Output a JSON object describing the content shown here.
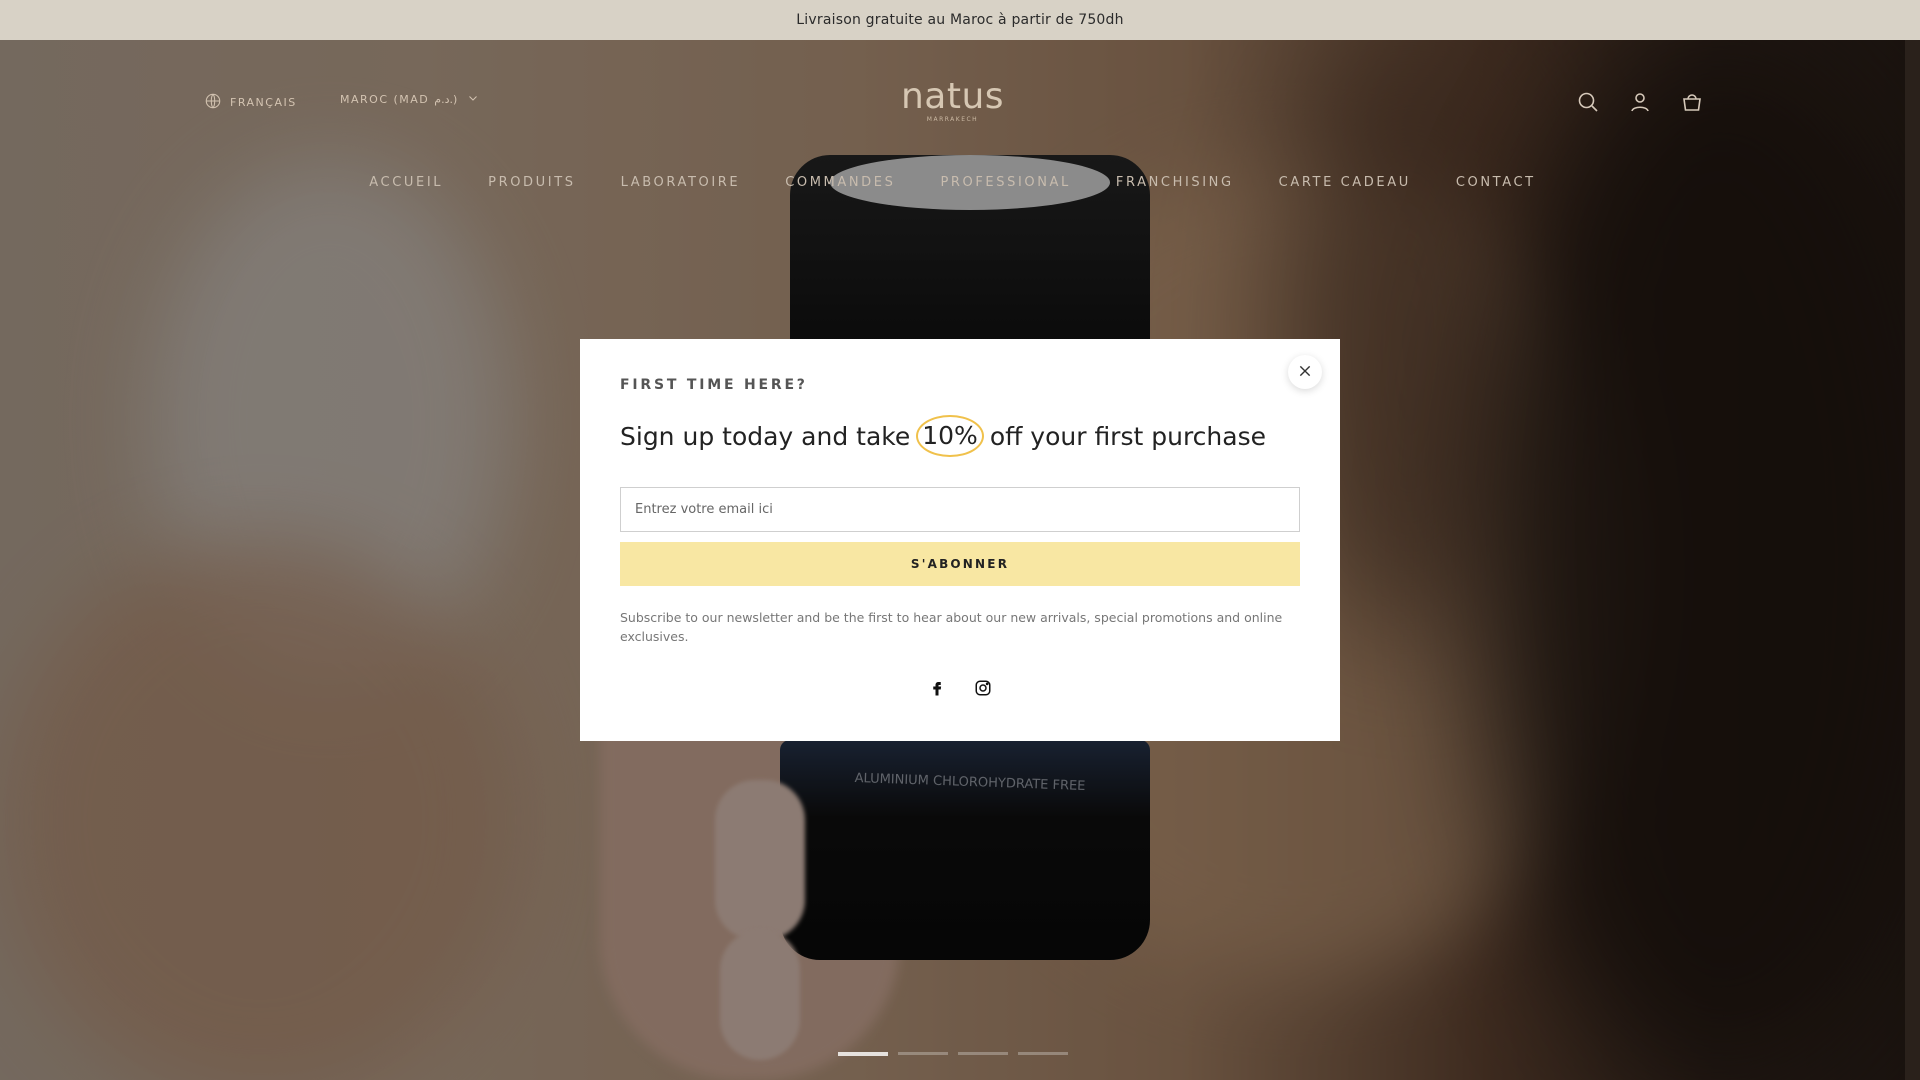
{
  "announcement": {
    "text": "Livraison gratuite au Maroc à partir de 750dh"
  },
  "header": {
    "language": "FRANÇAIS",
    "currency": "MAROC (MAD د.م.)",
    "logo": {
      "name": "natus",
      "tagline": "MARRAKECH"
    },
    "icons": [
      "search-icon",
      "account-icon",
      "cart-icon"
    ]
  },
  "nav": {
    "items": [
      {
        "label": "ACCUEIL"
      },
      {
        "label": "PRODUITS"
      },
      {
        "label": "LABORATOIRE"
      },
      {
        "label": "COMMANDES"
      },
      {
        "label": "PROFESSIONAL"
      },
      {
        "label": "FRANCHISING"
      },
      {
        "label": "CARTE CADEAU"
      },
      {
        "label": "CONTACT"
      }
    ]
  },
  "hero": {
    "product_label": "ALUMINIUM CHLOROHYDRATE FREE",
    "slide_count": 4,
    "active_slide": 1
  },
  "popup": {
    "eyebrow": "FIRST TIME HERE?",
    "headline_before": "Sign up today and take",
    "headline_highlight": "10%",
    "headline_after": "off your first purchase",
    "email_placeholder": "Entrez votre email ici",
    "button_label": "S'ABONNER",
    "disclaimer": "Subscribe to our newsletter and be the first to hear about our new arrivals, special promotions and online exclusives.",
    "social": [
      "facebook-icon",
      "instagram-icon"
    ],
    "accent_color": "#f0c14b",
    "button_color": "#f8e7a3"
  }
}
